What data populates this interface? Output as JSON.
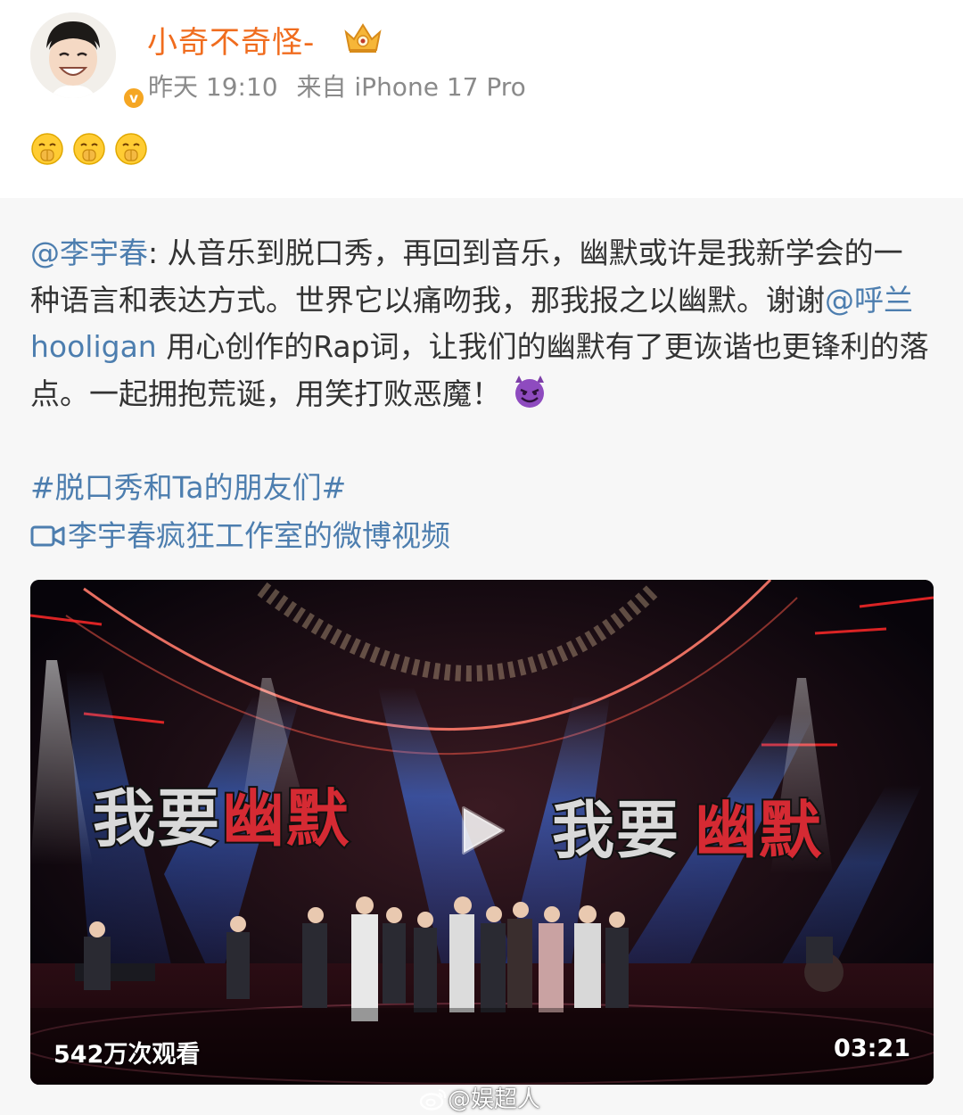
{
  "post": {
    "username": "小奇不奇怪-",
    "time": "昨天 19:10",
    "source": "来自 iPhone 17 Pro",
    "verified_mark": "v",
    "emoji_count": 3,
    "emoji_name": "shushing-face-icon"
  },
  "repost": {
    "mention_author": "@李宇春",
    "text_part1": ": 从音乐到脱口秀，再回到音乐，幽默或许是我新学会的一种语言和表达方式。世界它以痛吻我，那我报之以幽默。谢谢",
    "mention_hooligan": "@呼兰hooligan",
    "text_part2": " 用心创作的Rap词，让我们的幽默有了更诙谐也更锋利的落点。一起拥抱荒诞，用笑打败恶魔！",
    "end_emoji": "smiling-face-with-horns-icon",
    "topic": "#脱口秀和Ta的朋友们#",
    "video_link_label": "李宇春疯狂工作室的微博视频"
  },
  "video": {
    "banner_text_left": "我要幽默",
    "banner_text_right": "我要幽默",
    "views": "542万次观看",
    "duration": "03:21"
  },
  "watermark": "@娱超人",
  "colors": {
    "username": "#f06c1e",
    "link": "#4d7eaf",
    "meta": "#8a8a8a",
    "repost_bg": "#f7f7f7",
    "verified": "#f5a623"
  }
}
